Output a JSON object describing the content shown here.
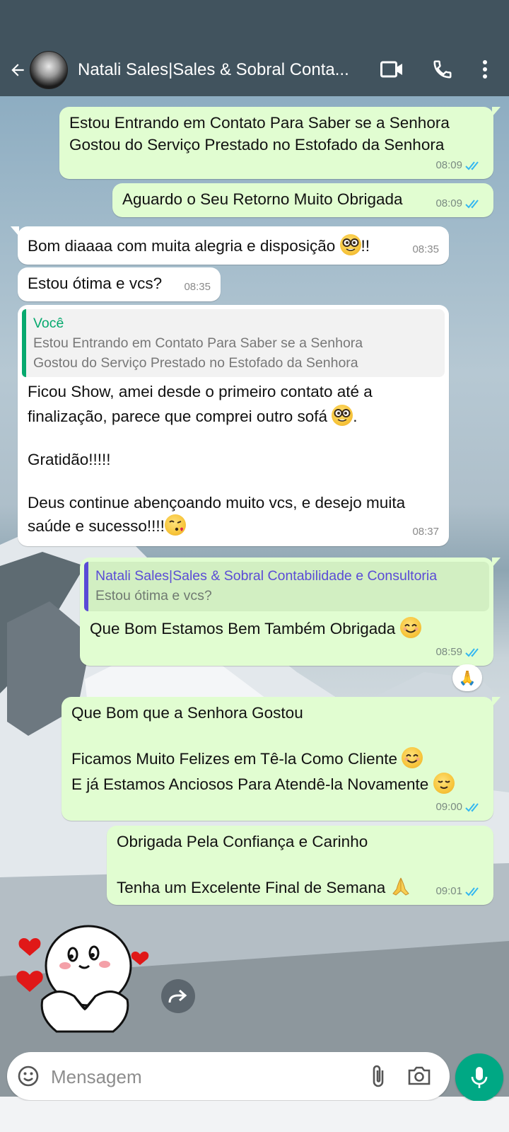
{
  "header": {
    "title": "Natali Sales|Sales & Sobral Conta..."
  },
  "messages": [
    {
      "dir": "out",
      "lines": [
        "Estou Entrando em Contato Para Saber se a Senhora",
        "Gostou do Serviço Prestado no Estofado da Senhora"
      ],
      "time": "08:09",
      "read": true
    },
    {
      "dir": "out",
      "lines": [
        "Aguardo o Seu Retorno Muito Obrigada"
      ],
      "time": "08:09",
      "read": true
    },
    {
      "dir": "in",
      "lines": [
        "Bom diaaaa com muita alegria e disposição",
        "!!"
      ],
      "time": "08:35"
    },
    {
      "dir": "in",
      "lines": [
        "Estou ótima e vcs?"
      ],
      "time": "08:35"
    },
    {
      "dir": "in",
      "quote": {
        "author": "Você",
        "lines": [
          "Estou Entrando em Contato Para Saber se a Senhora",
          "Gostou do Serviço Prestado no Estofado da Senhora"
        ]
      },
      "lines": [
        "Ficou Show, amei desde o primeiro contato até a",
        "finalização, parece que comprei outro sofá",
        ".",
        "Gratidão!!!!!",
        "Deus continue abençoando muito vcs, e desejo muita",
        "saúde e sucesso!!!!"
      ],
      "time": "08:37"
    },
    {
      "dir": "out",
      "quote": {
        "author": "Natali Sales|Sales & Sobral Contabilidade e Consultoria",
        "lines": [
          "Estou ótima e vcs?"
        ]
      },
      "lines": [
        "Que Bom Estamos Bem Também Obrigada"
      ],
      "time": "08:59",
      "read": true,
      "reaction": "🙏"
    },
    {
      "dir": "out",
      "lines": [
        "Que Bom que a Senhora Gostou",
        "Ficamos Muito Felizes em Tê-la Como Cliente",
        "E já Estamos Anciosos Para Atendê-la Novamente"
      ],
      "time": "09:00",
      "read": true
    },
    {
      "dir": "out",
      "lines": [
        "Obrigada Pela Confiança e Carinho",
        "Tenha um Excelente Final de Semana"
      ],
      "time": "09:01",
      "read": true
    }
  ],
  "composer": {
    "placeholder": "Mensagem"
  },
  "icons": {
    "back": "arrow-left-icon",
    "video": "video-call-icon",
    "call": "phone-icon",
    "menu": "more-vert-icon",
    "emoji": "emoji-icon",
    "attach": "paperclip-icon",
    "camera": "camera-icon",
    "mic": "microphone-icon",
    "forward": "forward-icon"
  },
  "colors": {
    "header": "#41535e",
    "outgoing_bubble": "#e1fdd1",
    "incoming_bubble": "#ffffff",
    "accent": "#00a884",
    "read_ticks": "#34b7f1",
    "quote_self": "#06a96e",
    "quote_contact": "#5a4bd6"
  }
}
